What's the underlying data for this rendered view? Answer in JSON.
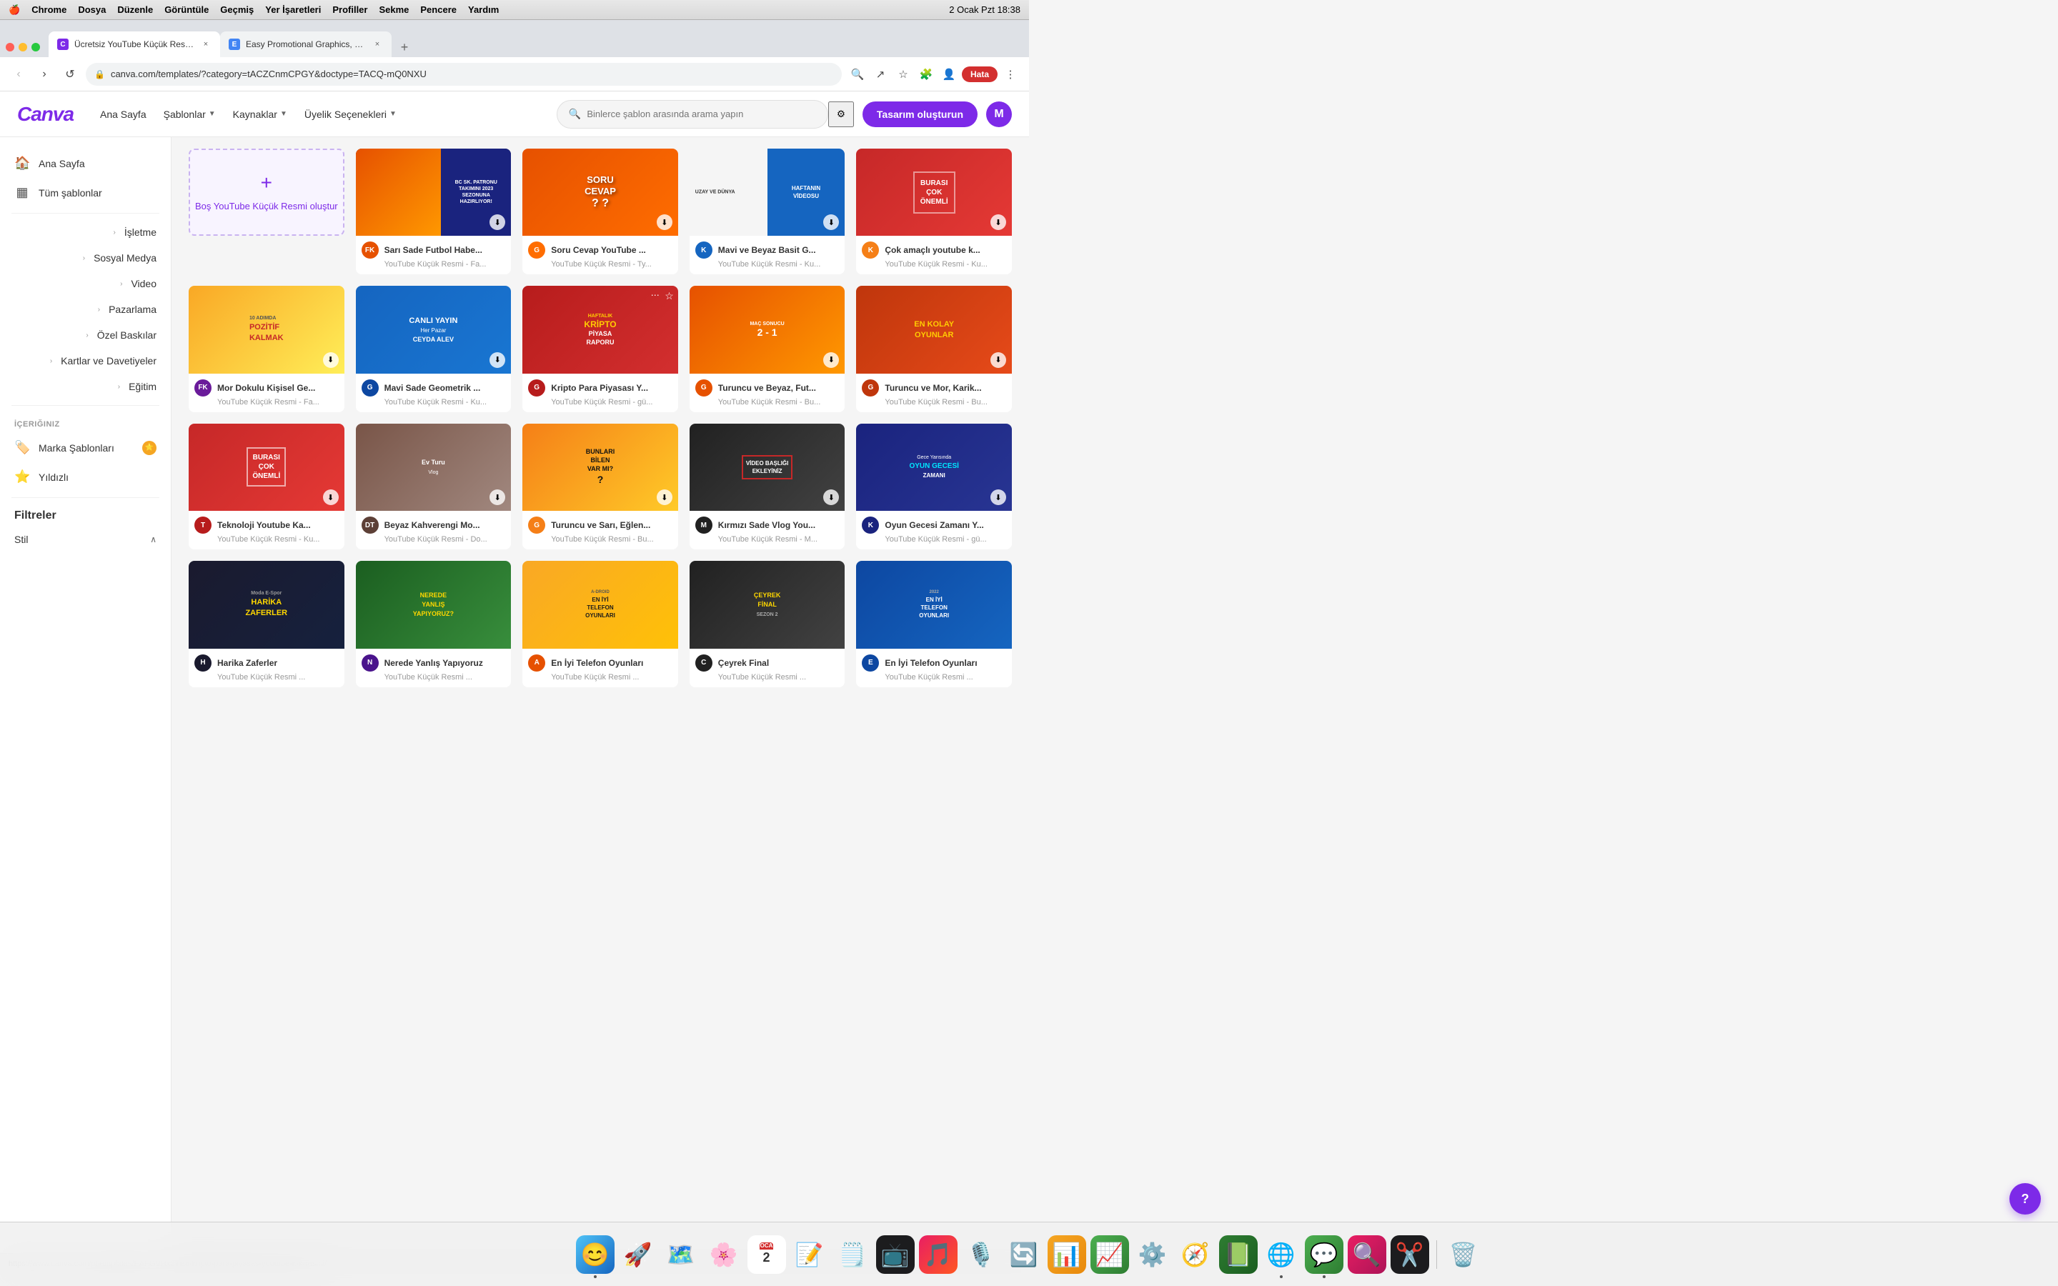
{
  "macos": {
    "bar_items": [
      "Chrome",
      "Dosya",
      "Düzenle",
      "Görüntüle",
      "Geçmiş",
      "Yer İşaretleri",
      "Profiller",
      "Sekme",
      "Pencere",
      "Yardım"
    ],
    "time": "2 Ocak Pzt  18:38"
  },
  "chrome": {
    "tabs": [
      {
        "id": "tab1",
        "title": "Ücretsiz YouTube Küçük Resim...",
        "favicon_color": "#7d2ae8",
        "active": true
      },
      {
        "id": "tab2",
        "title": "Easy Promotional Graphics, Vid...",
        "favicon_color": "#4285f4",
        "active": false
      }
    ],
    "url": "canva.com/templates/?category=tACZCnmCPGY&doctype=TACQ-mQ0NXU",
    "error_btn": "Hata"
  },
  "canva_nav": {
    "logo": "Canva",
    "links": [
      {
        "id": "home",
        "label": "Ana Sayfa",
        "has_arrow": false
      },
      {
        "id": "templates",
        "label": "Şablonlar",
        "has_arrow": true
      },
      {
        "id": "resources",
        "label": "Kaynaklar",
        "has_arrow": true
      },
      {
        "id": "membership",
        "label": "Üyelik Seçenekleri",
        "has_arrow": true
      }
    ],
    "search_placeholder": "Binlerce şablon arasında arama yapın",
    "create_btn": "Tasarım oluşturun",
    "user_initial": "M"
  },
  "sidebar": {
    "main_items": [
      {
        "id": "home",
        "icon": "🏠",
        "label": "Ana Sayfa"
      },
      {
        "id": "all_templates",
        "icon": "📋",
        "label": "Tüm şablonlar"
      }
    ],
    "category_items": [
      {
        "id": "business",
        "icon": "💼",
        "label": "İşletme",
        "expand": true
      },
      {
        "id": "social",
        "icon": "📱",
        "label": "Sosyal Medya",
        "expand": true
      },
      {
        "id": "video",
        "icon": "🎬",
        "label": "Video",
        "expand": false
      },
      {
        "id": "marketing",
        "icon": "📢",
        "label": "Pazarlama",
        "expand": true
      },
      {
        "id": "custom_print",
        "icon": "🖨️",
        "label": "Özel Baskılar",
        "expand": true
      },
      {
        "id": "cards",
        "icon": "🎴",
        "label": "Kartlar ve Davetiyeler",
        "expand": true
      },
      {
        "id": "education",
        "icon": "🎓",
        "label": "Eğitim",
        "expand": true
      }
    ],
    "section_title": "İçeriğiniz",
    "content_items": [
      {
        "id": "brand_templates",
        "icon": "🏷️",
        "label": "Marka Şablonları",
        "badge": true
      },
      {
        "id": "starred",
        "icon": "⭐",
        "label": "Yıldızlı"
      }
    ],
    "filter_title": "Filtreler",
    "filters": [
      {
        "id": "style",
        "label": "Stil",
        "expanded": true
      }
    ]
  },
  "templates": {
    "cards": [
      {
        "id": "card_create",
        "type": "create",
        "title": "Boş YouTube Küçük Resmi oluştur"
      },
      {
        "id": "card1",
        "bg": "orange",
        "title": "Sarı Sade Futbol Habe...",
        "subtitle": "YouTube Küçük Resmi - Fa...",
        "creator": "FK",
        "creator_color": "#e65100",
        "thumb_text": "BC SK. PATRONU\nTAKIMINI 2023\nSEZONUNA\nHAZIRLIYOR!",
        "thumb_class": "thumb-orange"
      },
      {
        "id": "card2",
        "bg": "orange2",
        "title": "Soru Cevap YouTube ...",
        "subtitle": "YouTube Küçük Resmi - Ty...",
        "creator": "G",
        "creator_color": "#ff6d00",
        "thumb_text": "SORU\nCEVAP",
        "thumb_class": "thumb-orange2"
      },
      {
        "id": "card3",
        "bg": "blue",
        "title": "Mavi ve Beyaz Basit G...",
        "subtitle": "YouTube Küçük Resmi - Ku...",
        "creator": "K",
        "creator_color": "#1565c0",
        "thumb_text": "HAFTANIN\nVİDEOSU",
        "thumb_class": "thumb-cyan"
      },
      {
        "id": "card4",
        "bg": "yellow",
        "title": "Çok amaçlı youtube k...",
        "subtitle": "YouTube Küçük Resmi - Ku...",
        "creator": "K",
        "creator_color": "#f57f17",
        "thumb_text": "BURASI\nÇOK ÖNEMLİ",
        "thumb_class": "thumb-yellow-red"
      },
      {
        "id": "card5",
        "bg": "yellow2",
        "title": "Mor Dokulu Kişisel Ge...",
        "subtitle": "YouTube Küçük Resmi - Fa...",
        "creator": "FK",
        "creator_color": "#6a1b9a",
        "thumb_text": "10 ADIMDA\nPOZİTİF\nKALMAK",
        "thumb_class": "thumb-yellow2"
      },
      {
        "id": "card6",
        "bg": "blue2",
        "title": "Mavi Sade Geometrik ...",
        "subtitle": "YouTube Küçük Resmi - Ku...",
        "creator": "G",
        "creator_color": "#0d47a1",
        "thumb_text": "CANLI YAYIN\nHer Pazar\nCEYDA ALEV",
        "thumb_class": "thumb-blue"
      },
      {
        "id": "card7",
        "bg": "red",
        "title": "Kripto Para Piyasası Y...",
        "subtitle": "YouTube Küçük Resmi - gü...",
        "creator": "G",
        "creator_color": "#b71c1c",
        "thumb_text": "KRİPTO\nPİYASA\nRAPORU",
        "thumb_class": "thumb-red",
        "has_star": true
      },
      {
        "id": "card8",
        "bg": "orange3",
        "title": "Turuncu ve Beyaz, Fut...",
        "subtitle": "YouTube Küçük Resmi - Bu...",
        "creator": "G",
        "creator_color": "#e65100",
        "thumb_text": "MAÇ SONUCU\n2 - 1",
        "thumb_class": "thumb-orange"
      },
      {
        "id": "card9",
        "bg": "orange4",
        "title": "Turuncu ve Mor, Karik...",
        "subtitle": "YouTube Küçük Resmi - Bu...",
        "creator": "G",
        "creator_color": "#bf360c",
        "thumb_text": "EN KOLAY\nOYUNLAR",
        "thumb_class": "thumb-orange2"
      },
      {
        "id": "card10",
        "bg": "red2",
        "title": "Teknoloji Youtube Ka...",
        "subtitle": "YouTube Küçük Resmi - Ku...",
        "creator": "T",
        "creator_color": "#b71c1c",
        "thumb_text": "BURASI\nÇOK ÖNEMLİ",
        "thumb_class": "thumb-red"
      },
      {
        "id": "card11",
        "bg": "brown",
        "title": "Beyaz Kahverengi Mo...",
        "subtitle": "YouTube Küçük Resmi - Do...",
        "creator": "DT",
        "creator_color": "#5d4037",
        "thumb_text": "Ev Turu\nVlog",
        "thumb_class": "thumb-brown"
      },
      {
        "id": "card12",
        "bg": "yellow3",
        "title": "Turuncu ve Sarı, Eğlen...",
        "subtitle": "YouTube Küçük Resmi - Bu...",
        "creator": "G",
        "creator_color": "#f57f17",
        "thumb_text": "BUNLARI\nBİLEN\nVAR MI?",
        "thumb_class": "thumb-yellow"
      },
      {
        "id": "card13",
        "bg": "dark",
        "title": "Kırmızı Sade Vlog You...",
        "subtitle": "YouTube Küçük Resmi - M...",
        "creator": "M",
        "creator_color": "#212121",
        "thumb_text": "VİDEO BAŞLIĞI\nEKLEYİNİZ",
        "thumb_class": "thumb-dark"
      },
      {
        "id": "card14",
        "bg": "dark2",
        "title": "Oyun Gecesi Zamanı Y...",
        "subtitle": "YouTube Küçük Resmi - gü...",
        "creator": "K",
        "creator_color": "#1a237e",
        "thumb_text": "Gece Yarısında\nOYUN GECESİ\nZAMANI",
        "thumb_class": "thumb-dark"
      },
      {
        "id": "card15",
        "bg": "dark3",
        "title": "Harika Zaferler",
        "subtitle": "YouTube Küçük Resmi ...",
        "creator": "H",
        "creator_color": "#1a1a2e",
        "thumb_text": "Moda E-Spor\nHARİKA\nZAFERLER",
        "thumb_class": "thumb-dark"
      },
      {
        "id": "card16",
        "bg": "purple2",
        "title": "Nerede Yanlış Yapıyoruz",
        "subtitle": "YouTube Küçük Resmi ...",
        "creator": "N",
        "creator_color": "#4a148c",
        "thumb_text": "NEREDE\nYANLIŞ\nYAPIYORUZ?",
        "thumb_class": "thumb-purple"
      },
      {
        "id": "card17",
        "bg": "yellow4",
        "title": "En İyi Telefon Oyunları",
        "subtitle": "YouTube Küçük Resmi ...",
        "creator": "A",
        "creator_color": "#e65100",
        "thumb_text": "A-DROID\nEN İYİ\nTELEFON\nOYUNLARI",
        "thumb_class": "thumb-yellow"
      },
      {
        "id": "card18",
        "bg": "dark4",
        "title": "Çeyrek Final",
        "subtitle": "YouTube Küçük Resmi ...",
        "creator": "C",
        "creator_color": "#212121",
        "thumb_text": "ÇEYREK\nFINAL\nSEZON 2",
        "thumb_class": "thumb-dark"
      },
      {
        "id": "card19",
        "bg": "blue3",
        "title": "En İyi Telefon Oyunları",
        "subtitle": "YouTube Küçük Resmi ...",
        "creator": "E",
        "creator_color": "#0d47a1",
        "thumb_text": "2022\nEN İYİ\nTELEFON\nOYUNLARI",
        "thumb_class": "thumb-blue"
      }
    ]
  },
  "dock": {
    "items": [
      {
        "id": "finder",
        "icon": "🖥️",
        "active": false,
        "label": "Finder"
      },
      {
        "id": "launchpad",
        "icon": "🚀",
        "active": false,
        "label": "Launchpad"
      },
      {
        "id": "maps",
        "icon": "🗺️",
        "active": false,
        "label": "Maps"
      },
      {
        "id": "photos",
        "icon": "🖼️",
        "active": false,
        "label": "Photos"
      },
      {
        "id": "calendar",
        "icon": "📅",
        "active": false,
        "label": "Calendar"
      },
      {
        "id": "reminders",
        "icon": "📝",
        "active": false,
        "label": "Reminders"
      },
      {
        "id": "notes",
        "icon": "🗒️",
        "active": false,
        "label": "Notes"
      },
      {
        "id": "appletv",
        "icon": "📺",
        "active": false,
        "label": "Apple TV"
      },
      {
        "id": "music",
        "icon": "🎵",
        "active": false,
        "label": "Music"
      },
      {
        "id": "podcasts",
        "icon": "🎙️",
        "active": false,
        "label": "Podcasts"
      },
      {
        "id": "migration",
        "icon": "🔄",
        "active": false,
        "label": "Migration"
      },
      {
        "id": "keynote",
        "icon": "📊",
        "active": false,
        "label": "Keynote"
      },
      {
        "id": "numbers",
        "icon": "📈",
        "active": false,
        "label": "Numbers"
      },
      {
        "id": "system",
        "icon": "⚙️",
        "active": false,
        "label": "System"
      },
      {
        "id": "safari",
        "icon": "🧭",
        "active": false,
        "label": "Safari"
      },
      {
        "id": "excel",
        "icon": "📗",
        "active": false,
        "label": "Excel"
      },
      {
        "id": "chrome",
        "icon": "🌐",
        "active": true,
        "label": "Chrome"
      },
      {
        "id": "messages",
        "icon": "💬",
        "active": false,
        "label": "Messages"
      },
      {
        "id": "raycast",
        "icon": "🔍",
        "active": false,
        "label": "Raycast"
      },
      {
        "id": "capcut",
        "icon": "✂️",
        "active": false,
        "label": "CapCut"
      },
      {
        "id": "trash",
        "icon": "🗑️",
        "active": false,
        "label": "Trash"
      }
    ]
  },
  "status_bar": {
    "url": "https://www.canva.com/p/templates/EAFGVHx2YE8-kripto-para-piyasas-youtube-k-k-resmi/"
  }
}
